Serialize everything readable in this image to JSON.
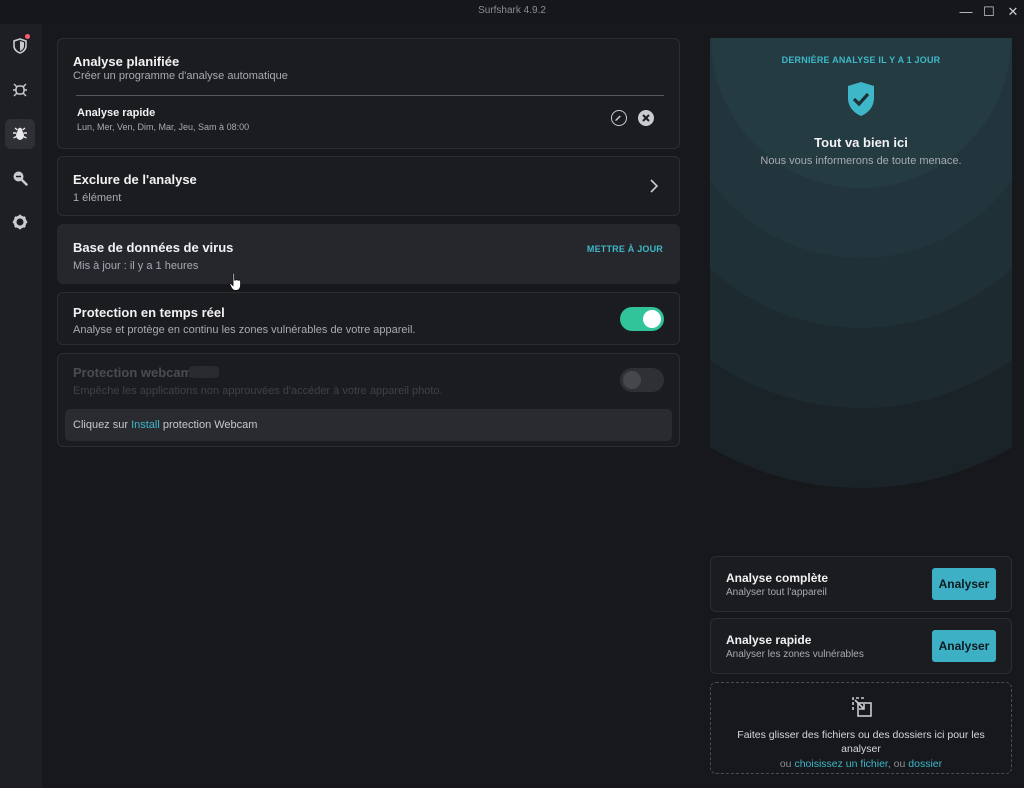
{
  "window": {
    "title": "Surfshark 4.9.2",
    "minimize": "—",
    "maximize": "☐",
    "close": "✕"
  },
  "sidebar": {
    "items": [
      "shield-alert-icon",
      "bug-scan-icon",
      "antivirus-icon",
      "search-leak-icon",
      "settings-icon"
    ],
    "active": "antivirus-icon"
  },
  "scheduled": {
    "title": "Analyse planifiée",
    "subtitle": "Créer un programme d'analyse automatique",
    "entry_title": "Analyse rapide",
    "entry_days": "Lun, Mer, Ven, Dim, Mar, Jeu, Sam à 08:00"
  },
  "exclude": {
    "title": "Exclure de l'analyse",
    "subtitle": "1 élément"
  },
  "database": {
    "title": "Base de données de virus",
    "subtitle": "Mis à jour : il y a 1 heures",
    "action": "METTRE À JOUR"
  },
  "realtime": {
    "title": "Protection en temps réel",
    "subtitle": "Analyse et protège en continu les zones vulnérables de votre appareil.",
    "enabled": true
  },
  "webcam": {
    "title": "Protection webcam",
    "subtitle": "Empêche les applications non approuvées d'accéder à votre appareil photo.",
    "enabled": false,
    "note_prefix": "Cliquez sur ",
    "note_link": "Install",
    "note_suffix": " protection Webcam"
  },
  "status": {
    "tag": "DERNIÈRE ANALYSE IL Y A 1 JOUR",
    "title": "Tout va bien ici",
    "subtitle": "Nous vous informerons de toute menace."
  },
  "scans": [
    {
      "title": "Analyse complète",
      "subtitle": "Analyser tout l'appareil",
      "button": "Analyser"
    },
    {
      "title": "Analyse rapide",
      "subtitle": "Analyser les zones vulnérables",
      "button": "Analyser"
    }
  ],
  "dropzone": {
    "text": "Faites glisser des fichiers ou des dossiers ici pour les analyser",
    "or1": "ou ",
    "link_file": "choisissez un fichier",
    "or2": ", ou ",
    "link_folder": "dossier"
  },
  "colors": {
    "accent": "#3eb8c9",
    "toggle_on": "#31c39a",
    "alert_dot": "#ff5a6a"
  }
}
